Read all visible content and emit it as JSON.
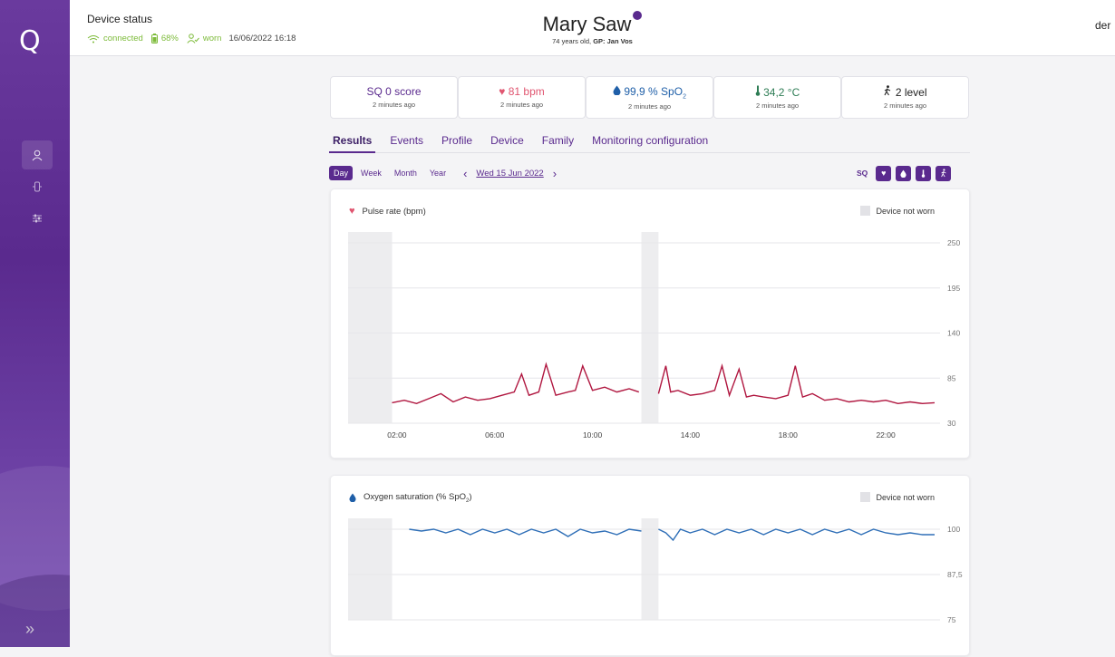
{
  "sidebar": {
    "logo": "Q",
    "expand": "»"
  },
  "device": {
    "title": "Device status",
    "connection": "connected",
    "battery": "68%",
    "worn": "worn",
    "datetime": "16/06/2022 16:18"
  },
  "patient": {
    "name": "Mary Saw",
    "age": "74 years old,",
    "gp_label": "GP:",
    "gp": "Jan Vos"
  },
  "user_truncated": "der",
  "metrics": [
    {
      "icon": "",
      "value": "SQ 0 score",
      "sub": "2 minutes ago",
      "color": "#5a2a8e"
    },
    {
      "icon": "♥",
      "value": "81 bpm",
      "sub": "2 minutes ago",
      "color": "#e05570"
    },
    {
      "icon": "●",
      "value": "99,9 % SpO",
      "sub": "2 minutes ago",
      "color": "#1f5fa8"
    },
    {
      "icon": "|",
      "value": "34,2 °C",
      "sub": "2 minutes ago",
      "color": "#2e7d55"
    },
    {
      "icon": "🚶",
      "value": "2 level",
      "sub": "2 minutes ago",
      "color": "#222"
    }
  ],
  "tabs": [
    "Results",
    "Events",
    "Profile",
    "Device",
    "Family",
    "Monitoring configuration"
  ],
  "ranges": [
    "Day",
    "Week",
    "Month",
    "Year"
  ],
  "date": "Wed 15 Jun 2022",
  "filter_label": "SQ",
  "not_worn_label": "Device not worn",
  "chart_data": [
    {
      "type": "line",
      "title": "Pulse rate (bpm)",
      "color": "#b0163f",
      "yticks": [
        "250",
        "195",
        "140",
        "85",
        "30"
      ],
      "ylim": [
        30,
        250
      ],
      "xticks": [
        "02:00",
        "06:00",
        "10:00",
        "14:00",
        "18:00",
        "22:00"
      ],
      "not_worn": [
        [
          0.0,
          1.8
        ],
        [
          12.0,
          12.7
        ]
      ],
      "x": [
        1.8,
        2.3,
        2.8,
        3.3,
        3.8,
        4.3,
        4.8,
        5.3,
        5.8,
        6.3,
        6.8,
        7.1,
        7.4,
        7.8,
        8.1,
        8.5,
        9.0,
        9.3,
        9.6,
        10.0,
        10.5,
        11.0,
        11.5,
        11.9,
        12.7,
        13.0,
        13.2,
        13.5,
        14.0,
        14.5,
        15.0,
        15.3,
        15.6,
        16.0,
        16.3,
        16.6,
        17.0,
        17.5,
        18.0,
        18.3,
        18.6,
        19.0,
        19.5,
        20.0,
        20.5,
        21.0,
        21.5,
        22.0,
        22.5,
        23.0,
        23.5,
        24.0
      ],
      "y": [
        55,
        58,
        54,
        60,
        66,
        56,
        62,
        58,
        60,
        64,
        68,
        90,
        64,
        68,
        102,
        64,
        68,
        70,
        100,
        70,
        74,
        68,
        72,
        68,
        66,
        100,
        68,
        70,
        64,
        66,
        70,
        100,
        64,
        96,
        62,
        64,
        62,
        60,
        64,
        100,
        62,
        66,
        58,
        60,
        56,
        58,
        56,
        58,
        54,
        56,
        54,
        55
      ]
    },
    {
      "type": "line",
      "title": "Oxygen saturation (% SpO",
      "color": "#2f6fb7",
      "yticks": [
        "100",
        "87,5",
        "75"
      ],
      "ylim": [
        75,
        100
      ],
      "xticks": [
        "02:00",
        "06:00",
        "10:00",
        "14:00",
        "18:00",
        "22:00"
      ],
      "not_worn": [
        [
          0.0,
          1.8
        ],
        [
          12.0,
          12.7
        ]
      ],
      "x": [
        1.8,
        2.5,
        3.0,
        3.5,
        4.0,
        4.5,
        5.0,
        5.5,
        6.0,
        6.5,
        7.0,
        7.5,
        8.0,
        8.5,
        9.0,
        9.5,
        10.0,
        10.5,
        11.0,
        11.5,
        12.0,
        12.7,
        13.0,
        13.3,
        13.6,
        14.0,
        14.5,
        15.0,
        15.5,
        16.0,
        16.5,
        17.0,
        17.5,
        18.0,
        18.5,
        19.0,
        19.5,
        20.0,
        20.5,
        21.0,
        21.5,
        22.0,
        22.5,
        23.0,
        23.5,
        24.0
      ],
      "y": [
        100,
        100,
        99.5,
        100,
        99,
        100,
        98.5,
        100,
        99,
        100,
        98.5,
        100,
        99,
        100,
        98,
        100,
        99,
        99.5,
        98.5,
        100,
        99.5,
        100,
        99,
        97,
        100,
        99,
        100,
        98.5,
        100,
        99,
        100,
        98.5,
        100,
        99,
        100,
        98.5,
        100,
        99,
        100,
        98.5,
        100,
        99,
        98.5,
        99,
        98.5,
        98.5
      ]
    }
  ]
}
